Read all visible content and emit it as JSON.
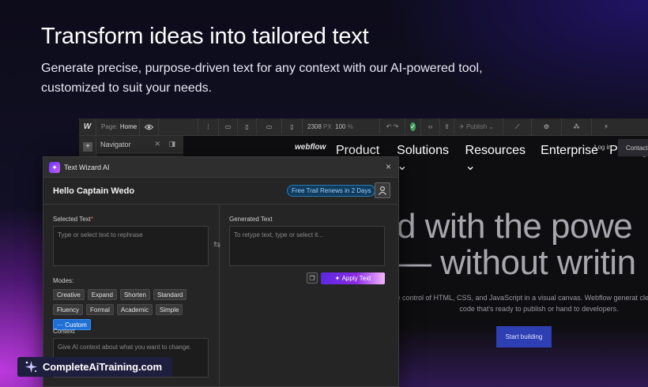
{
  "hero": {
    "title": "Transform ideas into tailored text",
    "subtitle": "Generate precise, purpose-driven text for any context with our AI-powered tool, customized to suit your needs."
  },
  "designer": {
    "toolbar": {
      "logo": "W",
      "page_label": "Page:",
      "page_name": "Home",
      "width": "2308",
      "width_unit": "PX",
      "zoom": "100",
      "zoom_unit": "%",
      "publish_label": "Publish"
    },
    "navigator_label": "Navigator",
    "site": {
      "logo": "webflow",
      "links": [
        "Product ⌄",
        "Solutions ⌄",
        "Resources ⌄",
        "Enterprise",
        "Pricing"
      ],
      "login": "Log in",
      "contact": "Contact",
      "headline_1": "d with the powe",
      "headline_2": "— without writin",
      "paragraph": "ake control of HTML, CSS, and JavaScript in a visual canvas. Webflow generat clean, semantic code that's ready to publish or hand to developers.",
      "cta": "Start building"
    }
  },
  "modal": {
    "title": "Text Wizard AI",
    "greeting": "Hello Captain Wedo",
    "trial_badge": "Free Trail Renews in 2 Days",
    "selected_label": "Selected Text",
    "selected_required": "*",
    "selected_placeholder": "Type or select text to rephrase",
    "generated_label": "Generated Text",
    "generated_placeholder": "To retype text, type or select it...",
    "apply_label": "Apply Text",
    "modes_label": "Modes:",
    "modes": [
      "Creative",
      "Expand",
      "Shorten",
      "Standard",
      "Fluency",
      "Formal",
      "Academic",
      "Simple",
      "··· Custom"
    ],
    "active_mode": "··· Custom",
    "context_label": "Context",
    "context_placeholder": "Give AI context about what you want to change."
  },
  "watermark": {
    "text": "CompleteAiTraining.com"
  },
  "colors": {
    "accent": "#1f6fd6",
    "apply_gradient_start": "#5a28e0",
    "cta": "#2d3fb2",
    "trial_border": "#2d7bb5"
  }
}
